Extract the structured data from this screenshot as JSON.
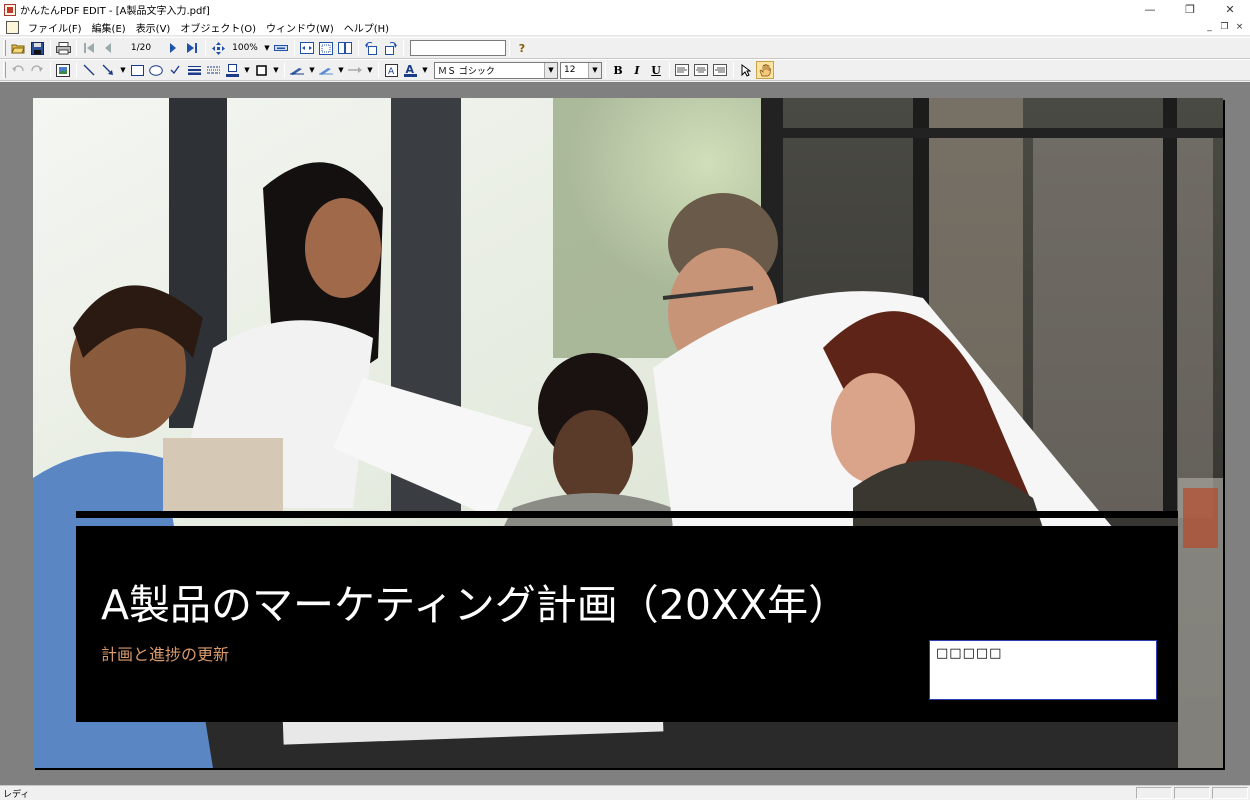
{
  "window": {
    "title": "かんたんPDF EDIT - [A製品文字入力.pdf]",
    "minimize": "—",
    "maximize": "❐",
    "close": "✕"
  },
  "menu": {
    "items": [
      "ファイル(F)",
      "編集(E)",
      "表示(V)",
      "オブジェクト(O)",
      "ウィンドウ(W)",
      "ヘルプ(H)"
    ],
    "mdi_minimize": "_",
    "mdi_restore": "❐",
    "mdi_close": "×"
  },
  "toolbar": {
    "page_indicator": "1/20",
    "zoom": "100%",
    "help": "?",
    "search_value": ""
  },
  "format_toolbar": {
    "font_name": "ＭＳ ゴシック",
    "font_size": "12",
    "bold": "B",
    "italic": "I",
    "underline": "U"
  },
  "document": {
    "title": "A製品のマーケティング計画（20XX年）",
    "subtitle": "計画と進捗の更新",
    "text_box_value": "□□□□□"
  },
  "status": {
    "text": "レディ"
  },
  "colors": {
    "subtitle_accent": "#d99a6c",
    "text_box_border": "#2d3eb4",
    "doc_background": "#808080"
  }
}
